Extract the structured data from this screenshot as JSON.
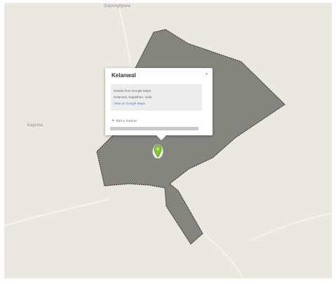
{
  "map": {
    "labels": {
      "top": "Gajsinghpura",
      "left": "Kaprina"
    },
    "colors": {
      "land": "#ebe8e1",
      "region_fill": "#858580",
      "region_border": "#3a3a3a",
      "marker": "#7ecb2a"
    },
    "marker_icon": "map-pin-icon"
  },
  "popup": {
    "title": "Kelanwal",
    "close_label": "×",
    "info_line_1": "Details from Google Maps",
    "info_line_2": "Kelanwal, Rajasthan, India",
    "info_link": "View on Google Maps",
    "action_plus": "+",
    "action_label": "Add a marker"
  }
}
